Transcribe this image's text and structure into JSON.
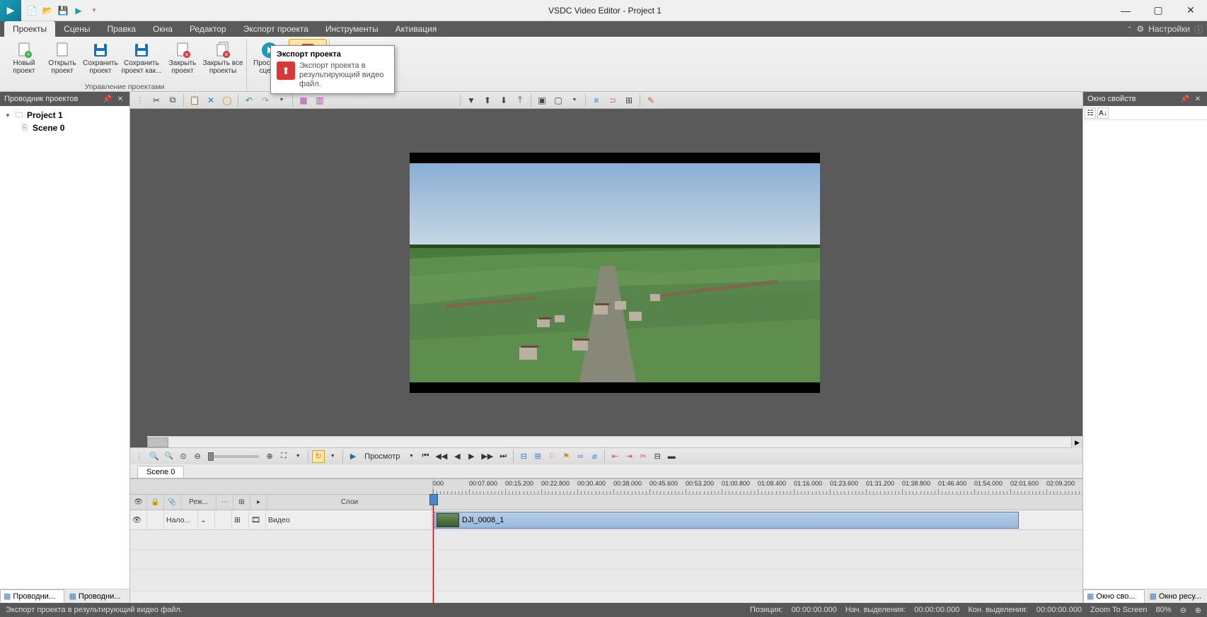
{
  "title": "VSDC Video Editor - Project 1",
  "settings_label": "Настройки",
  "menu": [
    "Проекты",
    "Сцены",
    "Правка",
    "Окна",
    "Редактор",
    "Экспорт проекта",
    "Инструменты",
    "Активация"
  ],
  "menu_active": 0,
  "ribbon": {
    "items": [
      {
        "label": "Новый\nпроект",
        "icon": "new"
      },
      {
        "label": "Открыть\nпроект",
        "icon": "open"
      },
      {
        "label": "Сохранить\nпроект",
        "icon": "save"
      },
      {
        "label": "Сохранить\nпроект как...",
        "icon": "saveas"
      },
      {
        "label": "Закрыть\nпроект",
        "icon": "close"
      },
      {
        "label": "Закрыть все\nпроекты",
        "icon": "closeall"
      },
      {
        "label": "Просмотр\nсцены",
        "icon": "play"
      },
      {
        "label": "Экспорт\nпроекта",
        "icon": "export"
      }
    ],
    "caption": "Управление проектами"
  },
  "tooltip": {
    "title": "Экспорт проекта",
    "desc": "Экспорт проекта в результирующий видео файл."
  },
  "left": {
    "title": "Проводник проектов",
    "project": "Project 1",
    "scene": "Scene 0",
    "tabs": [
      "Проводни...",
      "Проводни..."
    ]
  },
  "right": {
    "title": "Окно свойств",
    "tabs": [
      "Окно сво...",
      "Окно ресу..."
    ]
  },
  "controls": {
    "preview": "Просмотр"
  },
  "scene_tab": "Scene 0",
  "timeline": {
    "head": [
      "",
      "",
      "",
      "Реж...",
      "",
      "",
      "",
      "Слои"
    ],
    "track": [
      "",
      "",
      "Нало...",
      "",
      "",
      "",
      "",
      "Видео"
    ],
    "clip": "DJI_0008_1",
    "ticks": [
      "000",
      "00:07.600",
      "00:15.200",
      "00:22.800",
      "00:30.400",
      "00:38.000",
      "00:45.600",
      "00:53.200",
      "01:00.800",
      "01:08.400",
      "01:16.000",
      "01:23.600",
      "01:31.200",
      "01:38.800",
      "01:46.400",
      "01:54.000",
      "02:01.600",
      "02:09.200"
    ]
  },
  "status": {
    "hint": "Экспорт проекта в результирующий видео файл.",
    "pos_l": "Позиция:",
    "pos_v": "00:00:00.000",
    "sel_start_l": "Нач. выделения:",
    "sel_start_v": "00:00:00.000",
    "sel_end_l": "Кон. выделения:",
    "sel_end_v": "00:00:00.000",
    "zoom_l": "Zoom To Screen",
    "zoom_v": "80%"
  }
}
